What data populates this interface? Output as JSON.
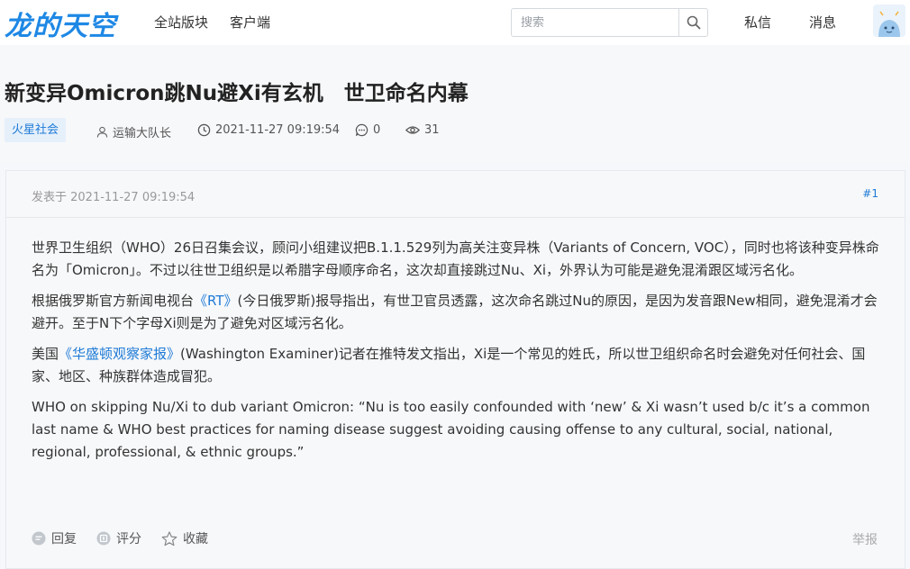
{
  "nav": {
    "logo": "龙的天空",
    "links": [
      "全站版块",
      "客户端"
    ],
    "search_placeholder": "搜索",
    "right_links": [
      "私信",
      "消息"
    ]
  },
  "post": {
    "title": "新变异Omicron跳Nu避Xi有玄机　世卫命名内幕",
    "tag": "火星社会",
    "author": "运输大队长",
    "datetime": "2021-11-27 09:19:54",
    "comments": "0",
    "views": "31"
  },
  "card": {
    "posted_label": "发表于 2021-11-27 09:19:54",
    "floor": "#1",
    "paragraphs": {
      "p1": "世界卫生组织（WHO）26日召集会议，顾问小组建议把B.1.1.529列为高关注变异株（Variants of Concern, VOC），同时也将该种变异株命名为「Omicron」。不过以往世卫组织是以希腊字母顺序命名，这次却直接跳过Nu、Xi，外界认为可能是避免混淆跟区域污名化。",
      "p2_pre": "根据俄罗斯官方新闻电视台",
      "p2_link": "《RT》",
      "p2_post": "(今日俄罗斯)报导指出，有世卫官员透露，这次命名跳过Nu的原因，是因为发音跟New相同，避免混淆才会避开。至于N下个字母Xi则是为了避免对区域污名化。",
      "p3_pre": "美国",
      "p3_link": "《华盛顿观察家报》",
      "p3_post": "(Washington Examiner)记者在推特发文指出，Xi是一个常见的姓氏，所以世卫组织命名时会避免对任何社会、国家、地区、种族群体造成冒犯。",
      "p4": "WHO on skipping Nu/Xi to dub variant Omicron: “Nu is too easily confounded with ‘new’ & Xi wasn’t used b/c it’s a common last name & WHO best practices for naming disease suggest avoiding causing offense to any cultural, social, national, regional, professional, & ethnic groups.”"
    },
    "actions": {
      "reply": "回复",
      "rate": "评分",
      "favorite": "收藏"
    },
    "report": "举报"
  },
  "icons": {
    "search": "search-icon",
    "user": "user-icon",
    "clock": "clock-icon",
    "comment": "comment-icon",
    "eye": "eye-icon",
    "reply": "reply-icon",
    "rate": "rate-icon",
    "star": "star-icon"
  },
  "colors": {
    "accent": "#1e7ad6",
    "logo": "#1e88e5",
    "tag_bg": "#e6f0fb"
  }
}
